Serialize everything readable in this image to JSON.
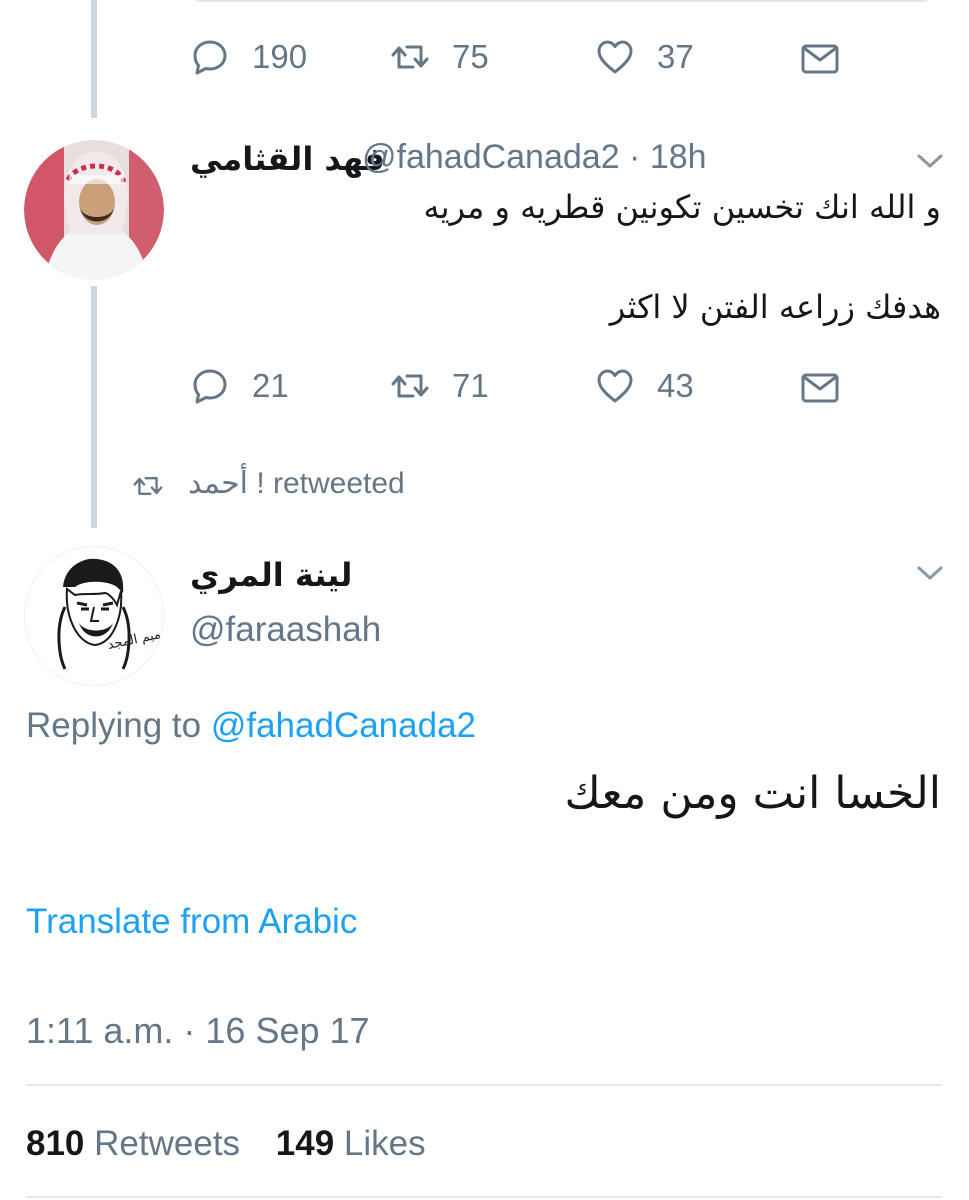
{
  "top_tweet": {
    "actions": {
      "replies": "190",
      "retweets": "75",
      "likes": "37"
    }
  },
  "reply_tweet": {
    "display_name": "فهد القثامي",
    "handle_time": "@fahadCanada2 · 18h",
    "text_line1": "و الله انك تخسين تكونين قطريه و مريه",
    "text_line2": "هدفك زراعه الفتن لا اكثر",
    "actions": {
      "replies": "21",
      "retweets": "71",
      "likes": "43"
    }
  },
  "retweet_context": {
    "label": "أحمد ! retweeted"
  },
  "main_tweet": {
    "display_name": "لينة المري",
    "handle": "@faraashah",
    "avatar_caption": "تميم المجد",
    "replying_prefix": "Replying to ",
    "replying_handle": "@fahadCanada2",
    "text": "الخسا انت ومن معك",
    "translate_label": "Translate from Arabic",
    "timestamp": "1:11 a.m. · 16 Sep 17",
    "stats": {
      "retweets_count": "810",
      "retweets_label": "Retweets",
      "likes_count": "149",
      "likes_label": "Likes"
    }
  },
  "colors": {
    "text": "#14171a",
    "muted": "#657786",
    "link": "#1da1f2",
    "line": "#ccd6dd",
    "divider": "#e1e8ed"
  },
  "icons": [
    "reply-icon",
    "retweet-icon",
    "like-icon",
    "direct-message-icon",
    "chevron-down-icon"
  ]
}
